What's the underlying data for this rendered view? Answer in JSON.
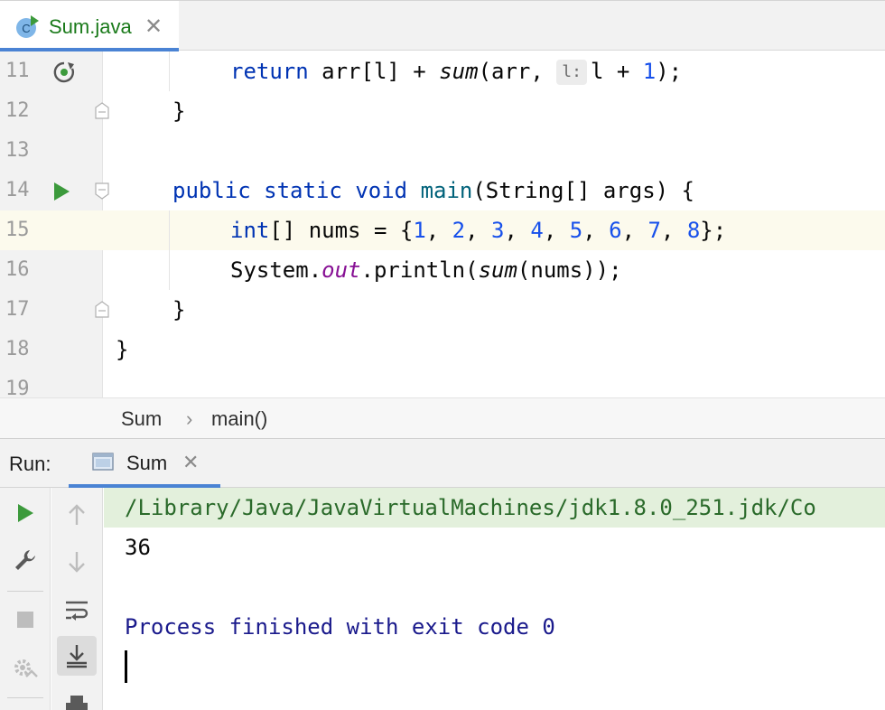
{
  "editor_tab": {
    "label": "Sum.java",
    "icon": "java-class-icon",
    "close": "✕"
  },
  "editor": {
    "lines": [
      {
        "num": "11",
        "gutter_icon": "recursive-call-icon"
      },
      {
        "num": "12"
      },
      {
        "num": "13"
      },
      {
        "num": "14",
        "gutter_icon": "run-icon"
      },
      {
        "num": "15",
        "current": true
      },
      {
        "num": "16"
      },
      {
        "num": "17"
      },
      {
        "num": "18"
      },
      {
        "num": "19"
      }
    ],
    "code": {
      "l11": {
        "kw": "return",
        "t1": " arr[l] + ",
        "call": "sum",
        "t2": "(arr, ",
        "hint": "l:",
        "t3": "l + ",
        "n": "1",
        "t4": ");"
      },
      "l12": "}",
      "l14": {
        "kw1": "public",
        "kw2": "static",
        "kw3": "void",
        "fn": "main",
        "rest": "(String[] args) {"
      },
      "l15": {
        "kw": "int",
        "t1": "[] nums = {",
        "nums": [
          "1",
          "2",
          "3",
          "4",
          "5",
          "6",
          "7",
          "8"
        ],
        "t2": "};"
      },
      "l16": {
        "t1": "System.",
        "fld": "out",
        "t2": ".println(",
        "call": "sum",
        "t3": "(nums));"
      },
      "l17": "}",
      "l18": "}"
    }
  },
  "breadcrumb": {
    "items": [
      "Sum",
      "main()"
    ],
    "separator": "›"
  },
  "run_panel": {
    "label": "Run:",
    "tab": {
      "label": "Sum",
      "close": "✕",
      "icon": "console-window-icon"
    },
    "console": {
      "path_line": "/Library/Java/JavaVirtualMachines/jdk1.8.0_251.jdk/Co",
      "output": "36",
      "process_line": "Process finished with exit code 0"
    }
  },
  "colors": {
    "keyword": "#0033b3",
    "number": "#1750eb",
    "field": "#871094",
    "method_decl": "#00627a",
    "run_green": "#3c9a3c",
    "tab_accent": "#4a83d4",
    "current_line": "#fcfaed",
    "console_path_bg": "#e3f0dc"
  }
}
